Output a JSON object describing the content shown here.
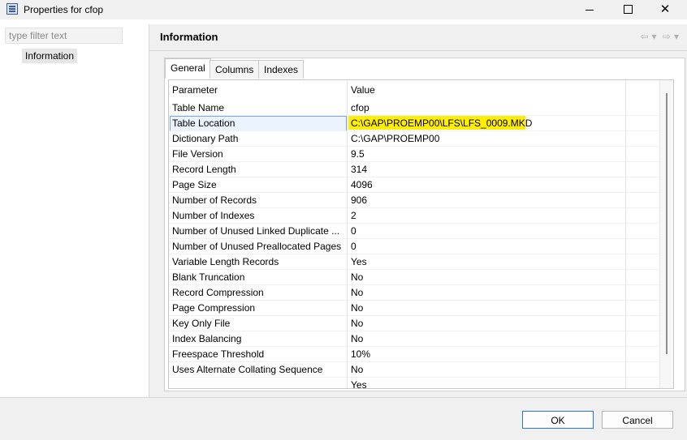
{
  "window": {
    "title": "Properties for cfop",
    "buttons": {
      "minimize": "—",
      "maximize": "☐",
      "close": "✕"
    }
  },
  "left": {
    "filter_placeholder": "type filter text",
    "tree_item": "Information"
  },
  "main": {
    "header": "Information",
    "nav": {
      "back": "⇦",
      "back_menu": "▾",
      "forward": "⇨",
      "forward_menu": "▾"
    },
    "tabs": [
      {
        "label": "General"
      },
      {
        "label": "Columns"
      },
      {
        "label": "Indexes"
      }
    ],
    "table": {
      "headers": {
        "param": "Parameter",
        "value": "Value"
      },
      "rows": [
        {
          "param": "Table Name",
          "value": "cfop"
        },
        {
          "param": "Table Location",
          "value": "C:\\GAP\\PROEMP00\\LFS\\LFS_0009.MKD"
        },
        {
          "param": "Dictionary Path",
          "value": "C:\\GAP\\PROEMP00"
        },
        {
          "param": "File Version",
          "value": "9.5"
        },
        {
          "param": "Record Length",
          "value": "314"
        },
        {
          "param": "Page Size",
          "value": "4096"
        },
        {
          "param": "Number of Records",
          "value": "906"
        },
        {
          "param": "Number of Indexes",
          "value": "2"
        },
        {
          "param": "Number of Unused Linked Duplicate ...",
          "value": "0"
        },
        {
          "param": "Number of Unused Preallocated Pages",
          "value": "0"
        },
        {
          "param": "Variable Length Records",
          "value": "Yes"
        },
        {
          "param": "Blank Truncation",
          "value": "No"
        },
        {
          "param": "Record Compression",
          "value": "No"
        },
        {
          "param": "Page Compression",
          "value": "No"
        },
        {
          "param": "Key Only File",
          "value": "No"
        },
        {
          "param": "Index Balancing",
          "value": "No"
        },
        {
          "param": "Freespace Threshold",
          "value": "10%"
        },
        {
          "param": "Uses Alternate Collating Sequence",
          "value": "No"
        },
        {
          "param": "",
          "value": "Yes"
        }
      ]
    }
  },
  "footer": {
    "ok": "OK",
    "cancel": "Cancel"
  },
  "colors": {
    "highlight": "#ffee00",
    "selection_border": "#7aa7e6"
  }
}
